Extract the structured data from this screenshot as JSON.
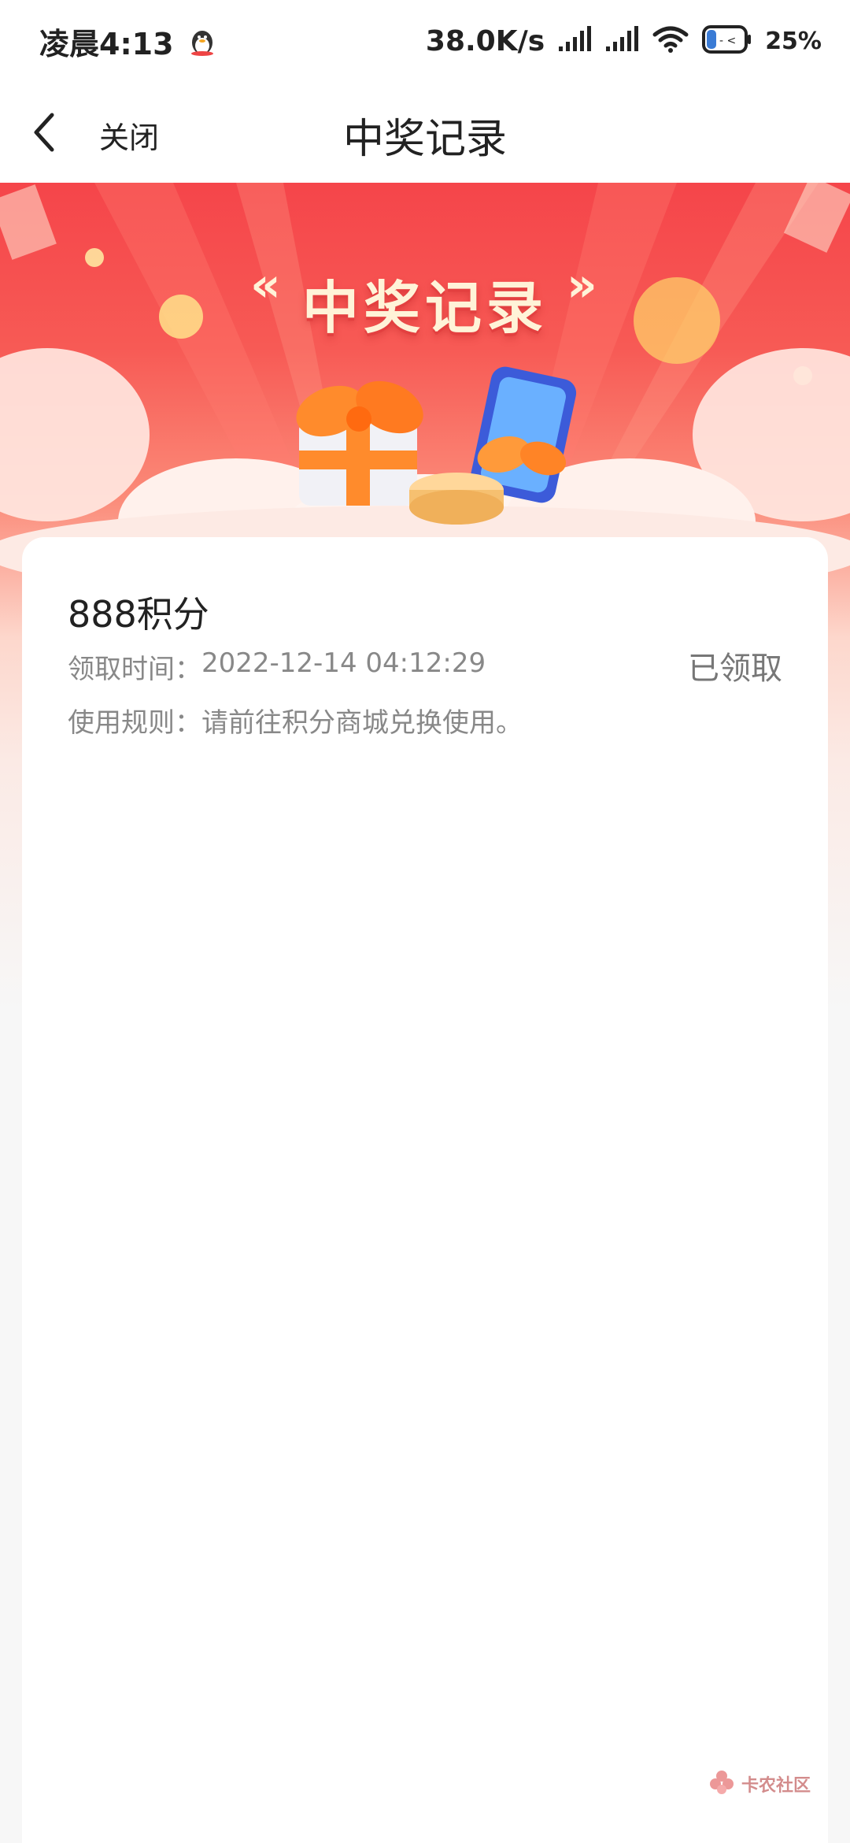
{
  "status_bar": {
    "time": "凌晨4:13",
    "net_speed": "38.0K/s",
    "battery": "25%"
  },
  "nav": {
    "close_label": "关闭",
    "title": "中奖记录"
  },
  "banner": {
    "title": "中奖记录"
  },
  "record": {
    "prize": "888积分",
    "receive_label": "领取时间：",
    "receive_time": "2022-12-14 04:12:29",
    "status": "已领取",
    "rule_label": "使用规则：",
    "rule_text": "请前往积分商城兑换使用。"
  },
  "watermark": {
    "text": "卡农社区"
  },
  "colors": {
    "banner_red": "#f5454a",
    "text_dark": "#222222",
    "text_gray": "#888888"
  }
}
